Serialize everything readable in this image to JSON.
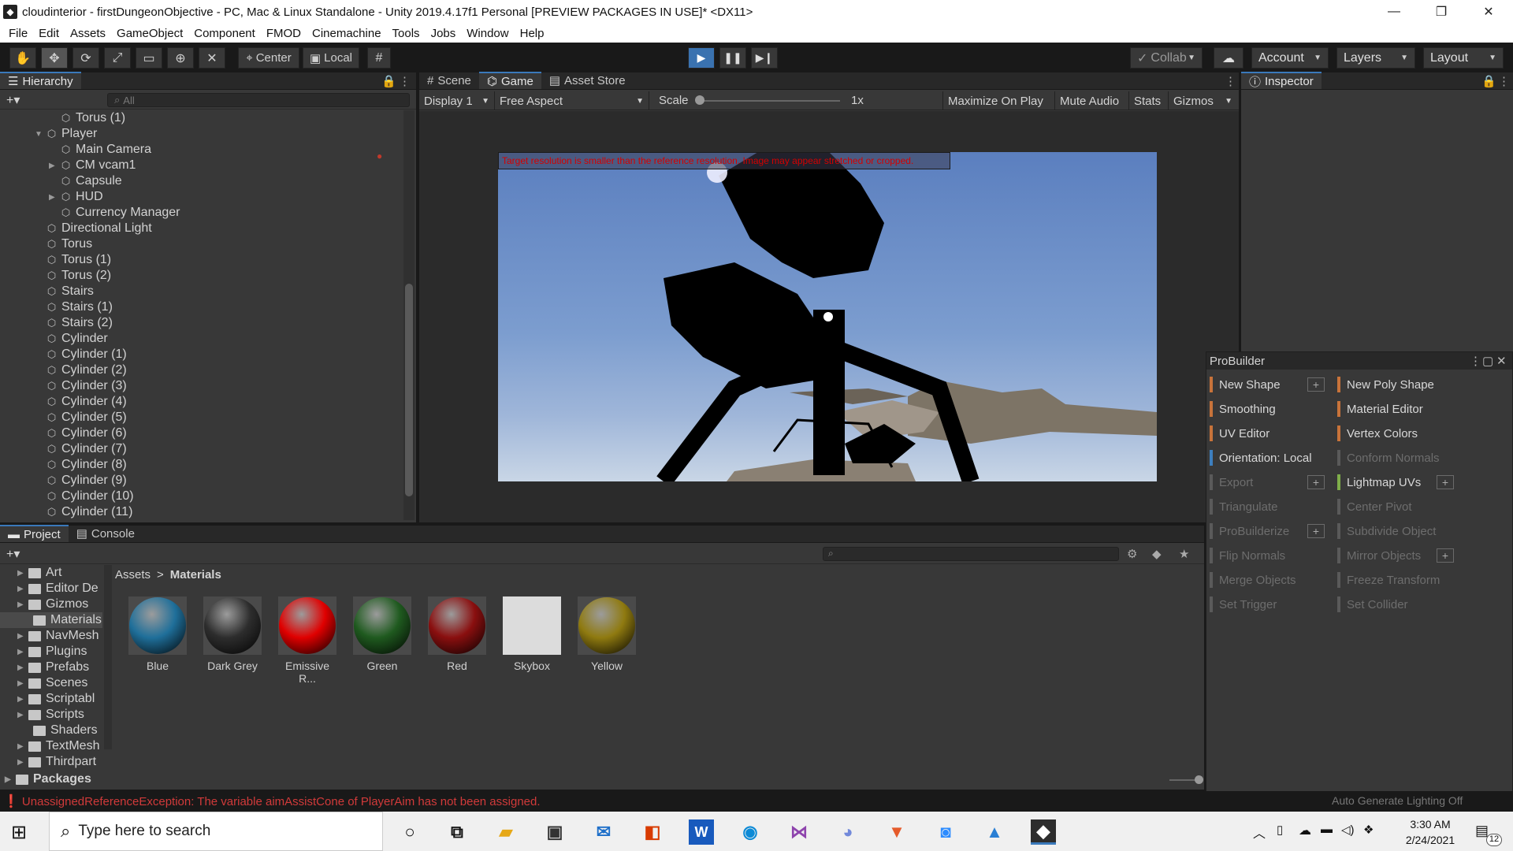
{
  "window": {
    "title": "cloudinterior - firstDungeonObjective - PC, Mac & Linux Standalone - Unity 2019.4.17f1 Personal [PREVIEW PACKAGES IN USE]* <DX11>",
    "minimize": "—",
    "restore": "❐",
    "close": "✕"
  },
  "menu": [
    "File",
    "Edit",
    "Assets",
    "GameObject",
    "Component",
    "FMOD",
    "Cinemachine",
    "Tools",
    "Jobs",
    "Window",
    "Help"
  ],
  "toolbar": {
    "pivot_center": "Center",
    "pivot_local": "Local",
    "collab": "Collab",
    "account": "Account",
    "layers": "Layers",
    "layout": "Layout"
  },
  "hierarchy": {
    "tab": "Hierarchy",
    "search_placeholder": "All",
    "rows": [
      {
        "label": "Torus (1)",
        "indent": 2,
        "arrow": ""
      },
      {
        "label": "Player",
        "indent": 1,
        "arrow": "▼"
      },
      {
        "label": "Main Camera",
        "indent": 2,
        "arrow": ""
      },
      {
        "label": "CM vcam1",
        "indent": 2,
        "arrow": "▶"
      },
      {
        "label": "Capsule",
        "indent": 2,
        "arrow": ""
      },
      {
        "label": "HUD",
        "indent": 2,
        "arrow": "▶"
      },
      {
        "label": "Currency Manager",
        "indent": 2,
        "arrow": ""
      },
      {
        "label": "Directional Light",
        "indent": 1,
        "arrow": ""
      },
      {
        "label": "Torus",
        "indent": 1,
        "arrow": ""
      },
      {
        "label": "Torus (1)",
        "indent": 1,
        "arrow": ""
      },
      {
        "label": "Torus (2)",
        "indent": 1,
        "arrow": ""
      },
      {
        "label": "Stairs",
        "indent": 1,
        "arrow": ""
      },
      {
        "label": "Stairs (1)",
        "indent": 1,
        "arrow": ""
      },
      {
        "label": "Stairs (2)",
        "indent": 1,
        "arrow": ""
      },
      {
        "label": "Cylinder",
        "indent": 1,
        "arrow": ""
      },
      {
        "label": "Cylinder (1)",
        "indent": 1,
        "arrow": ""
      },
      {
        "label": "Cylinder (2)",
        "indent": 1,
        "arrow": ""
      },
      {
        "label": "Cylinder (3)",
        "indent": 1,
        "arrow": ""
      },
      {
        "label": "Cylinder (4)",
        "indent": 1,
        "arrow": ""
      },
      {
        "label": "Cylinder (5)",
        "indent": 1,
        "arrow": ""
      },
      {
        "label": "Cylinder (6)",
        "indent": 1,
        "arrow": ""
      },
      {
        "label": "Cylinder (7)",
        "indent": 1,
        "arrow": ""
      },
      {
        "label": "Cylinder (8)",
        "indent": 1,
        "arrow": ""
      },
      {
        "label": "Cylinder (9)",
        "indent": 1,
        "arrow": ""
      },
      {
        "label": "Cylinder (10)",
        "indent": 1,
        "arrow": ""
      },
      {
        "label": "Cylinder (11)",
        "indent": 1,
        "arrow": ""
      }
    ]
  },
  "center_tabs": {
    "scene": "Scene",
    "game": "Game",
    "asset_store": "Asset Store"
  },
  "game": {
    "display": "Display 1",
    "aspect": "Free Aspect",
    "scale_label": "Scale",
    "scale_value": "1x",
    "maximize": "Maximize On Play",
    "mute": "Mute Audio",
    "stats": "Stats",
    "gizmos": "Gizmos",
    "warning": "Target resolution is smaller than the reference resolution. Image may appear stretched or cropped."
  },
  "inspector": {
    "tab": "Inspector"
  },
  "probuilder": {
    "title": "ProBuilder",
    "left": [
      {
        "label": "New Shape",
        "color": "#c8733a",
        "dim": false,
        "plus": true
      },
      {
        "label": "Smoothing",
        "color": "#c8733a",
        "dim": false,
        "plus": false
      },
      {
        "label": "UV Editor",
        "color": "#c8733a",
        "dim": false,
        "plus": false
      },
      {
        "label": "Orientation: Local",
        "color": "#3d7fbf",
        "dim": false,
        "plus": false
      },
      {
        "label": "Export",
        "color": "#5a5a5a",
        "dim": true,
        "plus": true
      },
      {
        "label": "Triangulate",
        "color": "#5a5a5a",
        "dim": true,
        "plus": false
      },
      {
        "label": "ProBuilderize",
        "color": "#5a5a5a",
        "dim": true,
        "plus": true
      },
      {
        "label": "Flip Normals",
        "color": "#5a5a5a",
        "dim": true,
        "plus": false
      },
      {
        "label": "Merge Objects",
        "color": "#5a5a5a",
        "dim": true,
        "plus": false
      },
      {
        "label": "Set Trigger",
        "color": "#5a5a5a",
        "dim": true,
        "plus": false
      }
    ],
    "right": [
      {
        "label": "New Poly Shape",
        "color": "#c8733a",
        "dim": false,
        "plus": false
      },
      {
        "label": "Material Editor",
        "color": "#c8733a",
        "dim": false,
        "plus": false
      },
      {
        "label": "Vertex Colors",
        "color": "#c8733a",
        "dim": false,
        "plus": false
      },
      {
        "label": "Conform Normals",
        "color": "#5a5a5a",
        "dim": true,
        "plus": false
      },
      {
        "label": "Lightmap UVs",
        "color": "#7fae4a",
        "dim": false,
        "plus": true
      },
      {
        "label": "Center Pivot",
        "color": "#5a5a5a",
        "dim": true,
        "plus": false
      },
      {
        "label": "Subdivide Object",
        "color": "#5a5a5a",
        "dim": true,
        "plus": false
      },
      {
        "label": "Mirror Objects",
        "color": "#5a5a5a",
        "dim": true,
        "plus": true
      },
      {
        "label": "Freeze Transform",
        "color": "#5a5a5a",
        "dim": true,
        "plus": false
      },
      {
        "label": "Set Collider",
        "color": "#5a5a5a",
        "dim": true,
        "plus": false
      }
    ]
  },
  "project": {
    "tab_project": "Project",
    "tab_console": "Console",
    "breadcrumb_root": "Assets",
    "breadcrumb_sep": ">",
    "breadcrumb_leaf": "Materials",
    "folders": [
      "Art",
      "Editor De",
      "Gizmos",
      "Materials",
      "NavMesh",
      "Plugins",
      "Prefabs",
      "Scenes",
      "Scriptabl",
      "Scripts",
      "Shaders",
      "TextMesh",
      "Thirdpart"
    ],
    "packages": "Packages",
    "materials": [
      {
        "name": "Blue",
        "color": "#1f6f9a",
        "kind": "ball"
      },
      {
        "name": "Dark Grey",
        "color": "#2d2d2d",
        "kind": "ball"
      },
      {
        "name": "Emissive R...",
        "color": "#e00000",
        "kind": "ball"
      },
      {
        "name": "Green",
        "color": "#1f5a1f",
        "kind": "ball"
      },
      {
        "name": "Red",
        "color": "#8a0f0f",
        "kind": "ball"
      },
      {
        "name": "Skybox",
        "color": "#dcdcdc",
        "kind": "flat"
      },
      {
        "name": "Yellow",
        "color": "#8f7a10",
        "kind": "ball"
      }
    ]
  },
  "status": {
    "error": "UnassignedReferenceException: The variable aimAssistCone of PlayerAim has not been assigned.",
    "right": "Auto Generate Lighting Off"
  },
  "taskbar": {
    "search_placeholder": "Type here to search",
    "time": "3:30 AM",
    "date": "2/24/2021",
    "notifications": "12"
  }
}
